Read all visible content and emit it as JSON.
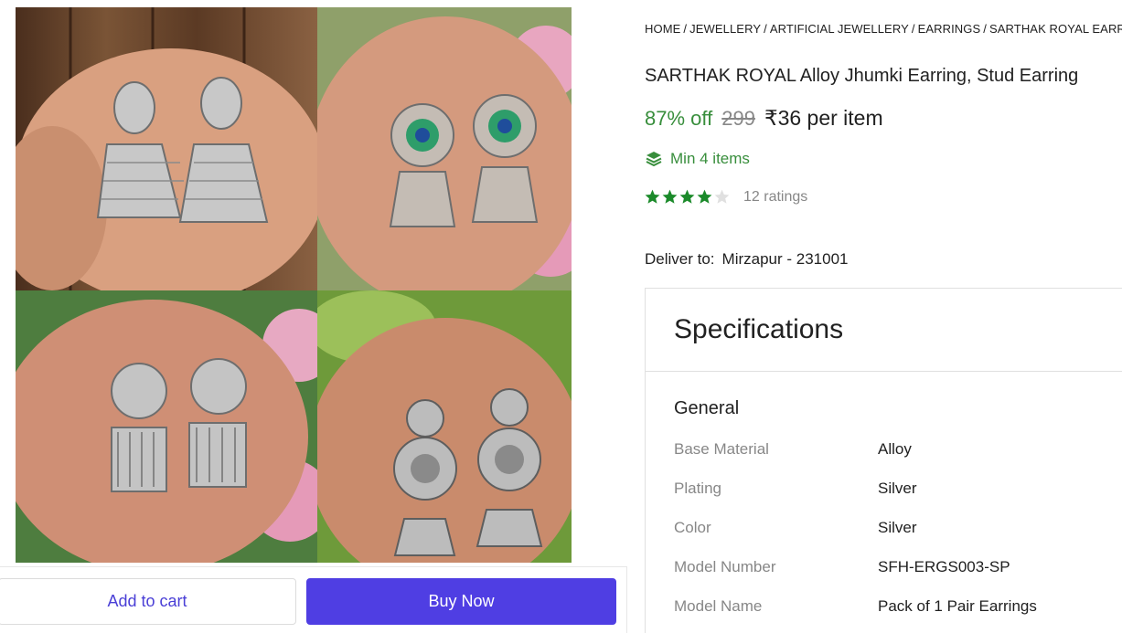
{
  "breadcrumb": [
    "HOME",
    "JEWELLERY",
    "ARTIFICIAL JEWELLERY",
    "EARRINGS",
    "SARTHAK ROYAL EARRING"
  ],
  "product": {
    "title": "SARTHAK ROYAL Alloy Jhumki Earring, Stud Earring",
    "discount": "87% off",
    "mrp": "299",
    "price": "₹36 per item",
    "min_order": "Min 4 items",
    "rating_stars": 4,
    "rating_max": 5,
    "ratings_count": "12 ratings"
  },
  "delivery": {
    "label": "Deliver to:",
    "location": "Mirzapur - 231001"
  },
  "specifications": {
    "heading": "Specifications",
    "group": "General",
    "rows": [
      {
        "key": "Base Material",
        "value": "Alloy"
      },
      {
        "key": "Plating",
        "value": "Silver"
      },
      {
        "key": "Color",
        "value": "Silver"
      },
      {
        "key": "Model Number",
        "value": "SFH-ERGS003-SP"
      },
      {
        "key": "Model Name",
        "value": "Pack of 1 Pair Earrings"
      }
    ]
  },
  "actions": {
    "add_to_cart": "Add to cart",
    "buy_now": "Buy Now"
  },
  "colors": {
    "green": "#388e3c",
    "star": "#1b8a2a",
    "buy": "#4f3ee3",
    "muted": "#878787"
  }
}
